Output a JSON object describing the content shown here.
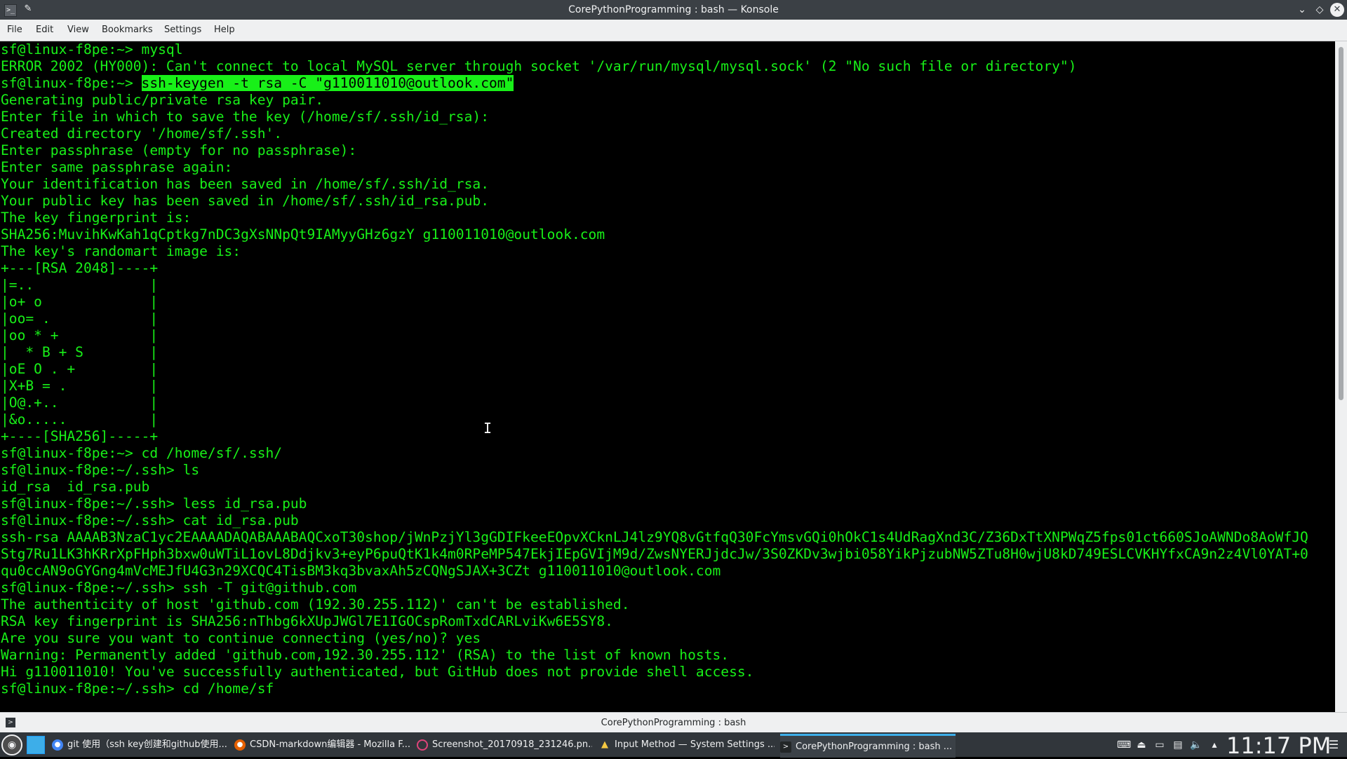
{
  "window": {
    "title": "CorePythonProgramming : bash — Konsole"
  },
  "menu": {
    "items": [
      "File",
      "Edit",
      "View",
      "Bookmarks",
      "Settings",
      "Help"
    ]
  },
  "terminal": {
    "lines": [
      "sf@linux-f8pe:~> mysql",
      "ERROR 2002 (HY000): Can't connect to local MySQL server through socket '/var/run/mysql/mysql.sock' (2 \"No such file or directory\")",
      "__PROMPT_HL__",
      "Generating public/private rsa key pair.",
      "Enter file in which to save the key (/home/sf/.ssh/id_rsa):",
      "Created directory '/home/sf/.ssh'.",
      "Enter passphrase (empty for no passphrase):",
      "Enter same passphrase again:",
      "Your identification has been saved in /home/sf/.ssh/id_rsa.",
      "Your public key has been saved in /home/sf/.ssh/id_rsa.pub.",
      "The key fingerprint is:",
      "SHA256:MuvihKwKah1qCptkg7nDC3gXsNNpQt9IAMyyGHz6gzY g110011010@outlook.com",
      "The key's randomart image is:",
      "+---[RSA 2048]----+",
      "|=..              |",
      "|o+ o             |",
      "|oo= .            |",
      "|oo * +           |",
      "|  * B + S        |",
      "|oE O . +         |",
      "|X+B = .          |",
      "|O@.+..           |",
      "|&o.....          |",
      "+----[SHA256]-----+",
      "sf@linux-f8pe:~> cd /home/sf/.ssh/",
      "sf@linux-f8pe:~/.ssh> ls",
      "id_rsa  id_rsa.pub",
      "sf@linux-f8pe:~/.ssh> less id_rsa.pub",
      "sf@linux-f8pe:~/.ssh> cat id_rsa.pub",
      "ssh-rsa AAAAB3NzaC1yc2EAAAADAQABAAABAQCxoT30shop/jWnPzjYl3gGDIFkeeEOpvXCknLJ4lz9YQ8vGtfqQ30FcYmsvGQi0hOkC1s4UdRagXnd3C/Z36DxTtXNPWqZ5fps01ct660SJoAWNDo8AoWfJQ",
      "Stg7Ru1LK3hKRrXpFHph3bxw0uWTiL1ovL8Ddjkv3+eyP6puQtK1k4m0RPeMP547EkjIEpGVIjM9d/ZwsNYERJjdcJw/3S0ZKDv3wjbi058YikPjzubNW5ZTu8H0wjU8kD749ESLCVKHYfxCA9n2z4Vl0YAT+0",
      "qu0ccAN9oGYGng4mVcMEJfU4G3n29XCQC4TisBM3kq3bvaxAh5zCQNgSJAX+3CZt g110011010@outlook.com",
      "sf@linux-f8pe:~/.ssh> ssh -T git@github.com",
      "The authenticity of host 'github.com (192.30.255.112)' can't be established.",
      "RSA key fingerprint is SHA256:nThbg6kXUpJWGl7E1IGOCspRomTxdCARLviKw6E5SY8.",
      "Are you sure you want to continue connecting (yes/no)? yes",
      "Warning: Permanently added 'github.com,192.30.255.112' (RSA) to the list of known hosts.",
      "Hi g110011010! You've successfully authenticated, but GitHub does not provide shell access.",
      "sf@linux-f8pe:~/.ssh> cd /home/sf"
    ],
    "highlight_prompt": "sf@linux-f8pe:~> ",
    "highlight_command": "ssh-keygen -t rsa -C \"g110011010@outlook.com\""
  },
  "tabbar": {
    "label": "CorePythonProgramming : bash"
  },
  "taskbar": {
    "tasks": [
      "git 使用（ssh key创建和github使用...",
      "CSDN-markdown编辑器 - Mozilla F...",
      "Screenshot_20170918_231246.pn...",
      "Input Method — System Settings ...",
      "CorePythonProgramming : bash ..."
    ],
    "clock": "11:17 PM"
  },
  "colors": {
    "terminal_fg": "#18f018",
    "terminal_bg": "#000000",
    "accent": "#3daee9"
  }
}
